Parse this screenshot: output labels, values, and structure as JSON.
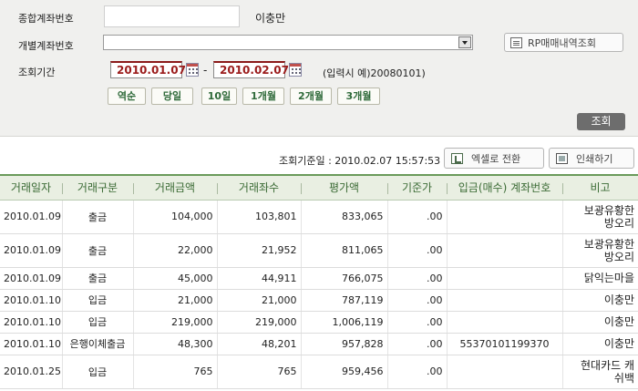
{
  "search": {
    "integrated_account_label": "종합계좌번호",
    "integrated_account_value": "",
    "owner_name": "이충만",
    "individual_account_label": "개별계좌번호",
    "individual_account_value": "",
    "rp_button_label": "RP매매내역조회",
    "period_label": "조회기간",
    "date_from": "2010.01.07",
    "date_to": "2010.02.07",
    "date_separator": "-",
    "date_hint": "(입력시 예)20080101)",
    "quick_buttons": [
      "역순",
      "당일",
      "10일",
      "1개월",
      "2개월",
      "3개월"
    ],
    "inquiry_button_label": "조회"
  },
  "toolbar": {
    "basis_label": "조회기준일 : 2010.02.07 15:57:53",
    "excel_button_label": "엑셀로 전환",
    "print_button_label": "인쇄하기"
  },
  "table": {
    "headers": [
      "거래일자",
      "거래구분",
      "거래금액",
      "거래좌수",
      "평가액",
      "기준가",
      "입금(매수) 계좌번호",
      "비고"
    ],
    "rows": [
      [
        "2010.01.09",
        "출금",
        "104,000",
        "103,801",
        "833,065",
        ".00",
        "",
        "보광유황한\n방오리"
      ],
      [
        "2010.01.09",
        "출금",
        "22,000",
        "21,952",
        "811,065",
        ".00",
        "",
        "보광유황한\n방오리"
      ],
      [
        "2010.01.09",
        "출금",
        "45,000",
        "44,911",
        "766,075",
        ".00",
        "",
        "닭익는마을"
      ],
      [
        "2010.01.10",
        "입금",
        "21,000",
        "21,000",
        "787,119",
        ".00",
        "",
        "이충만"
      ],
      [
        "2010.01.10",
        "입금",
        "219,000",
        "219,000",
        "1,006,119",
        ".00",
        "",
        "이충만"
      ],
      [
        "2010.01.10",
        "은행이체출금",
        "48,300",
        "48,201",
        "957,828",
        ".00",
        "55370101199370",
        "이충만"
      ],
      [
        "2010.01.25",
        "입금",
        "765",
        "765",
        "959,456",
        ".00",
        "",
        "현대카드 캐\n쉬백"
      ]
    ]
  }
}
